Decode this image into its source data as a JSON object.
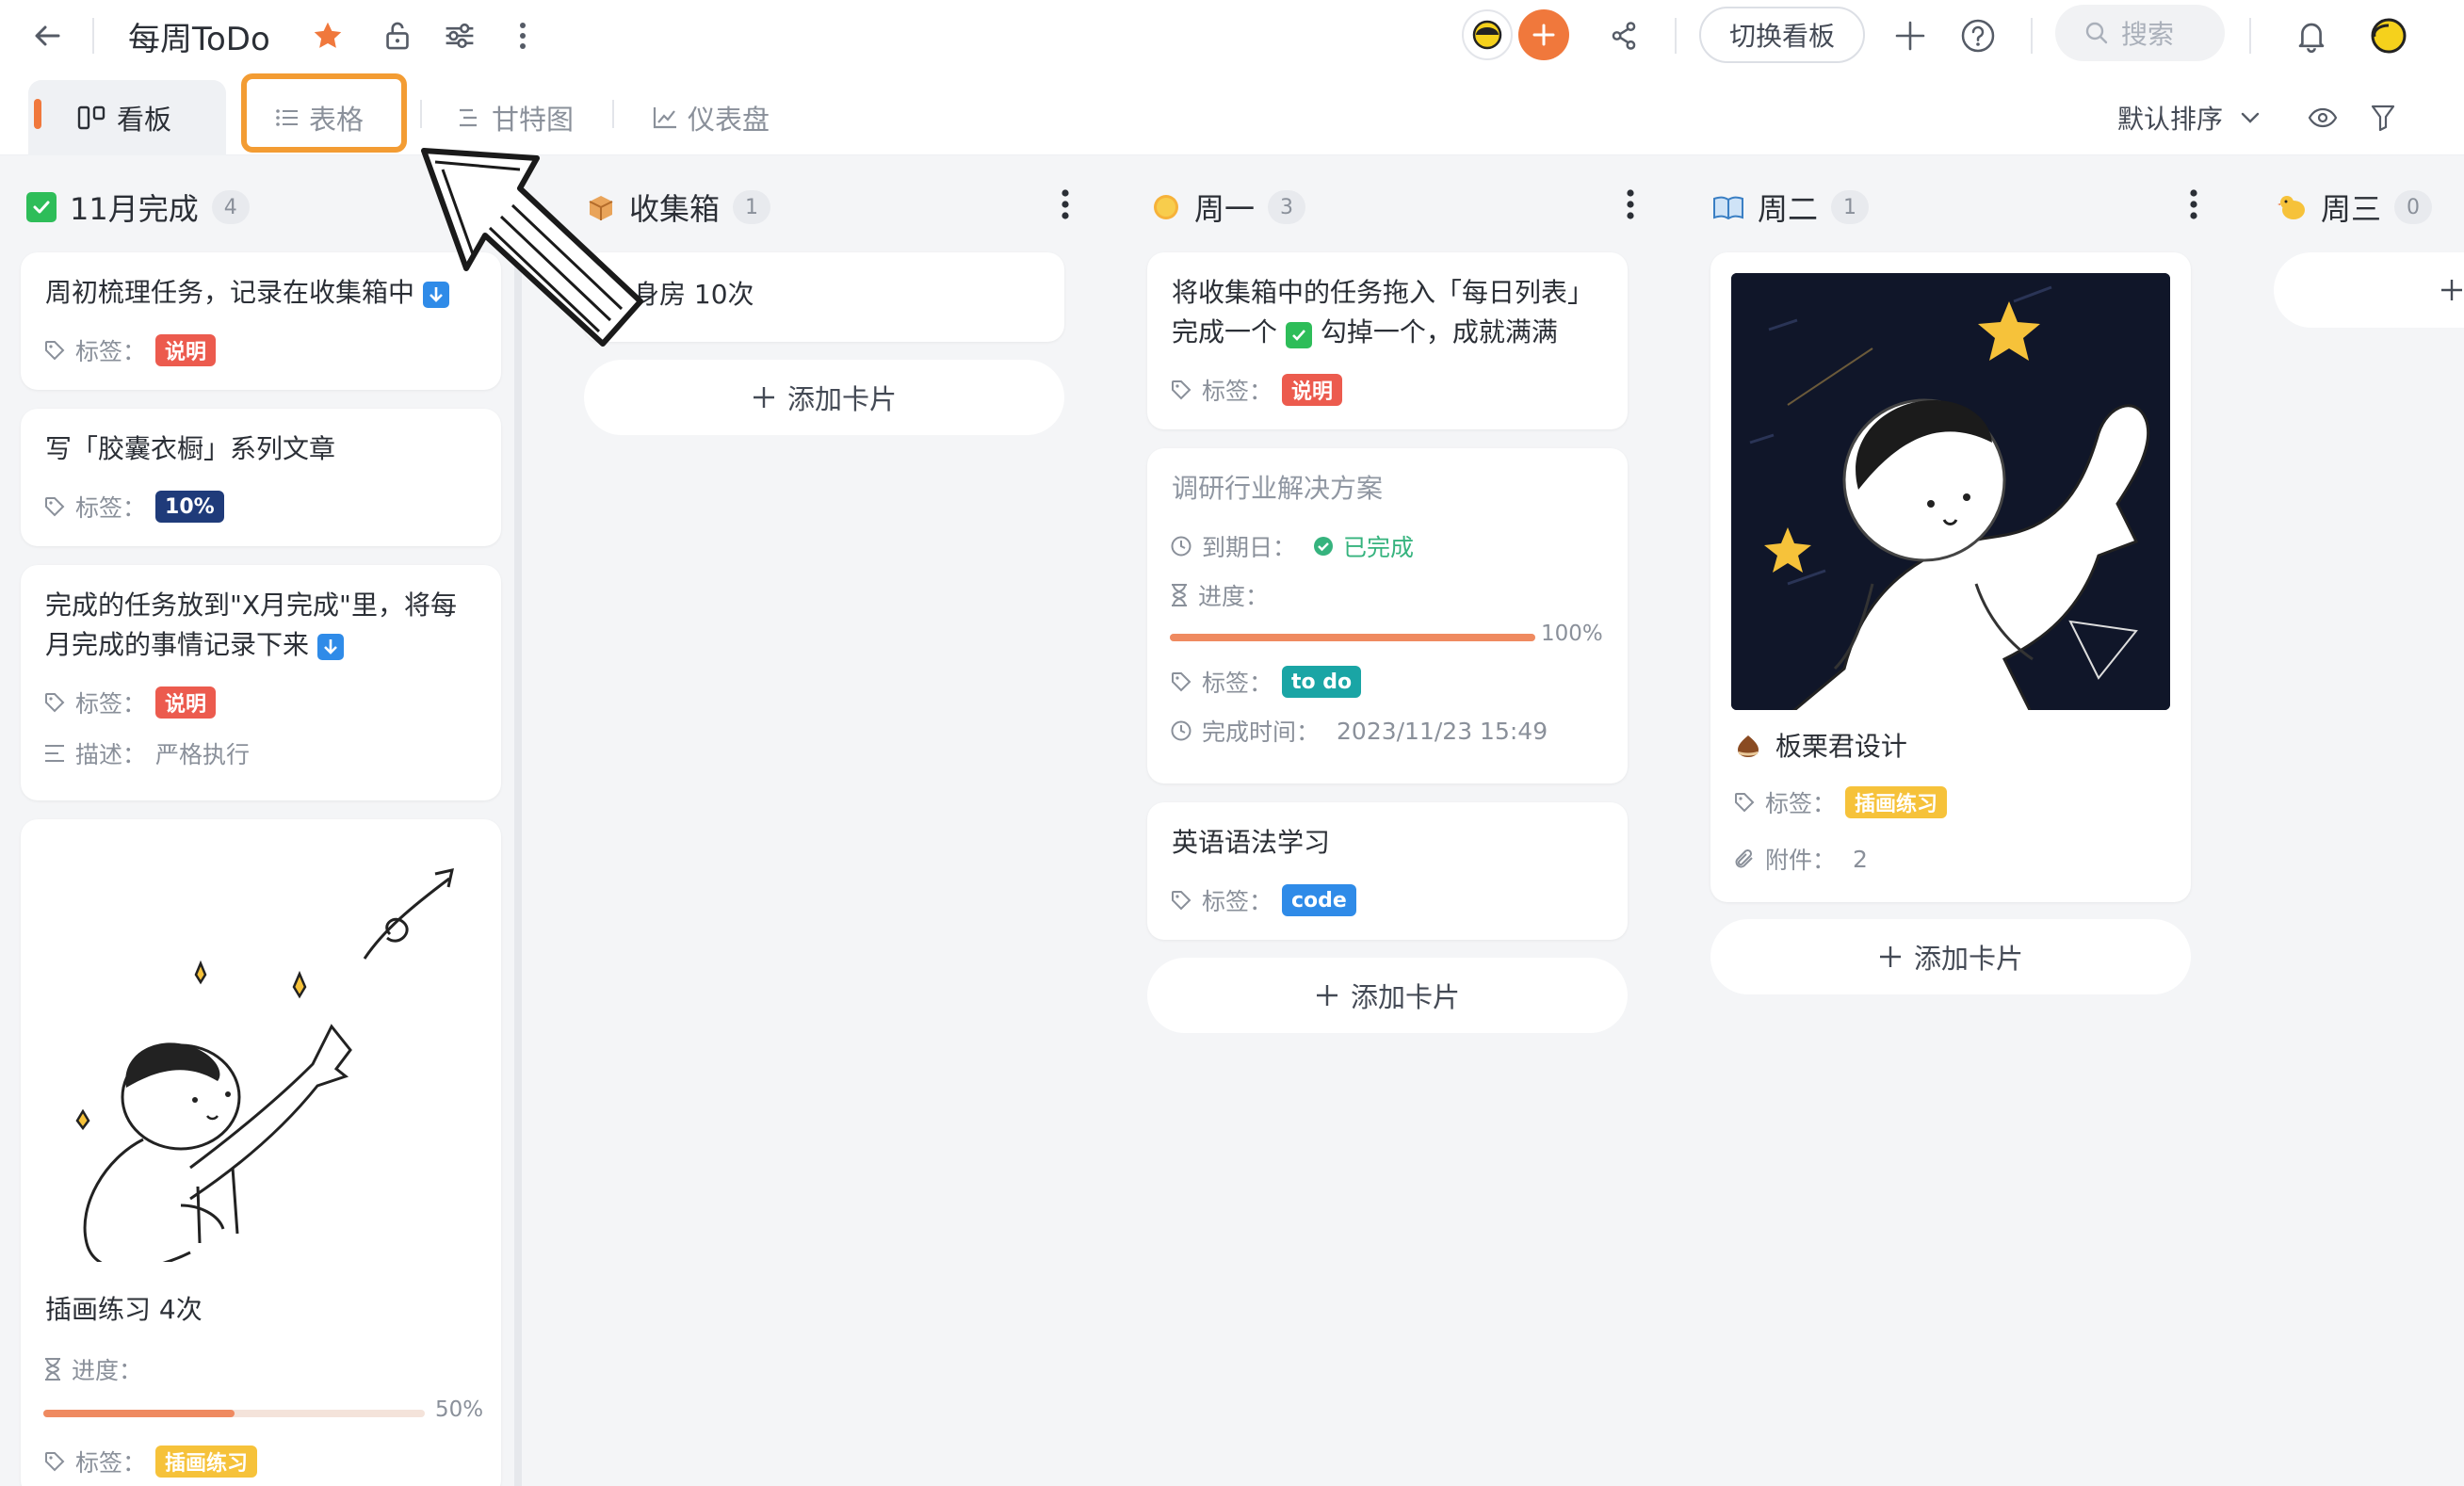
{
  "topbar": {
    "title": "每周ToDo",
    "switch_board_label": "切换看板",
    "search_placeholder": "搜索"
  },
  "tabs": [
    {
      "label": "看板",
      "icon": "kanban-icon"
    },
    {
      "label": "表格",
      "icon": "list-icon"
    },
    {
      "label": "甘特图",
      "icon": "gantt-icon"
    },
    {
      "label": "仪表盘",
      "icon": "chart-icon"
    }
  ],
  "toolbar": {
    "sort_label": "默认排序"
  },
  "field_labels": {
    "tag": "标签：",
    "progress": "进度：",
    "due": "到期日：",
    "desc": "描述：",
    "done_time": "完成时间：",
    "attachment": "附件："
  },
  "add_card_label": "添加卡片",
  "columns": [
    {
      "title": "11月完成",
      "count": "4",
      "cards": [
        {
          "title": "周初梳理任务，记录在收集箱中",
          "tag": "说明"
        },
        {
          "title": "写「胶囊衣橱」系列文章",
          "tag": "10%"
        },
        {
          "title_line1": "完成的任务放到\"X月完成\"里，将每",
          "title_line2": "月完成的事情记录下来",
          "tag": "说明",
          "desc": "严格执行"
        },
        {
          "title": "插画练习 4次",
          "progress_text": "50%",
          "progress": 0.5,
          "tag": "插画练习"
        }
      ]
    },
    {
      "title": "收集箱",
      "count": "1",
      "cards": [
        {
          "title": "身房 10次"
        }
      ]
    },
    {
      "title": "周一",
      "count": "3",
      "cards": [
        {
          "title_line1": "将收集箱中的任务拖入「每日列表」",
          "title_line2a": "完成一个",
          "title_line2b": "勾掉一个，成就满满",
          "tag": "说明"
        },
        {
          "title": "调研行业解决方案",
          "due_status": "已完成",
          "progress_text": "100%",
          "progress": 1.0,
          "tag": "to do",
          "done_time": "2023/11/23 15:49"
        },
        {
          "title": "英语语法学习",
          "tag": "code"
        }
      ]
    },
    {
      "title": "周二",
      "count": "1",
      "cards": [
        {
          "title": "板栗君设计",
          "tag": "插画练习",
          "attachments": "2"
        }
      ]
    },
    {
      "title": "周三",
      "count": "0",
      "cards": []
    }
  ],
  "colors": {
    "accent": "#f0783c",
    "tag_red": "#ec5b4e",
    "tag_navy": "#1f3b7a",
    "tag_teal": "#1aa5a5",
    "tag_blue": "#2f8be8",
    "tag_yellow": "#f6c23a",
    "done_green": "#36b37e",
    "highlight": "#f39c33"
  }
}
